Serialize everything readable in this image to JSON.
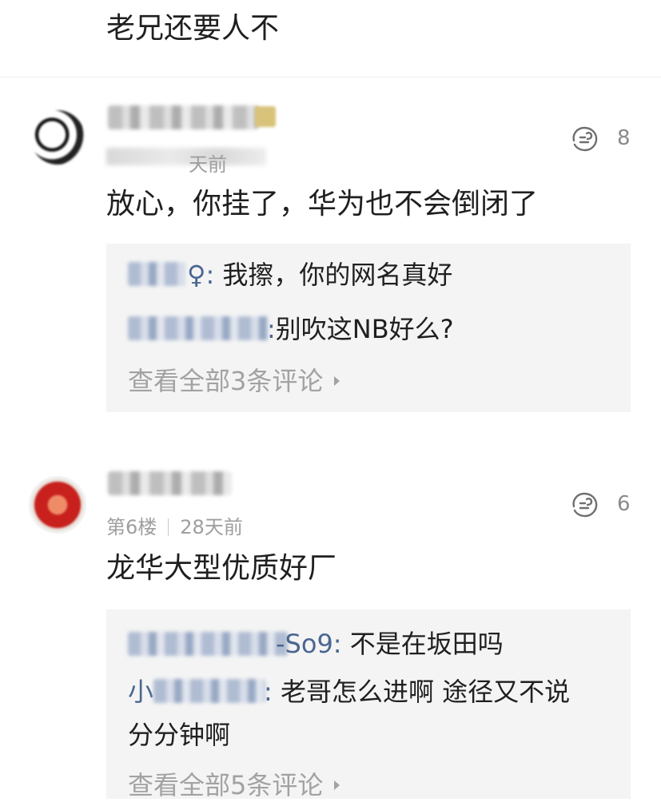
{
  "top_comment": {
    "text": "老兄还要人不"
  },
  "comments": [
    {
      "username": "",
      "floor": "",
      "time_suffix": "天前",
      "likes": "8",
      "body": "放心，你挂了，华为也不会倒闭了",
      "replies": [
        {
          "name_suffix": "♀:",
          "text": "我擦，你的网名真好"
        },
        {
          "name_suffix": ":",
          "text": "别吹这NB好么?"
        }
      ],
      "view_all": "查看全部3条评论"
    },
    {
      "username": "",
      "floor": "第6楼",
      "time": "28天前",
      "likes": "6",
      "body": "龙华大型优质好厂",
      "replies": [
        {
          "name_suffix": "-So9:",
          "text": "不是在坂田吗"
        },
        {
          "name_prefix": "小",
          "name_suffix": ":",
          "text": "老哥怎么进啊 途径又不说",
          "text_cont": "分分钟啊"
        }
      ],
      "view_all": "查看全部5条评论"
    }
  ],
  "icons": {
    "like": "thumbs-up-icon",
    "arrow": "chevron-right-icon"
  },
  "colors": {
    "reply_name": "#4a6791",
    "meta_gray": "#9e9e9e",
    "reply_bg": "#f4f4f4"
  }
}
